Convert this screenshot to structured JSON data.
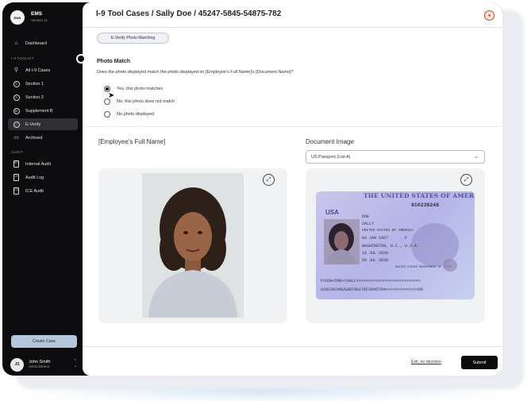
{
  "brand": {
    "logo_text": "EMS",
    "name": "EMS",
    "version": "Version 11"
  },
  "sidebar": {
    "dashboard": "Dashboard",
    "section_toolkit": "I-9 TOOLKIT",
    "items": [
      {
        "label": "All I-9 Cases",
        "icon": "search-icon"
      },
      {
        "label": "Section 1",
        "icon": "number-1-icon",
        "glyph": "1"
      },
      {
        "label": "Section 2",
        "icon": "number-2-icon",
        "glyph": "2"
      },
      {
        "label": "Supplement B",
        "icon": "letter-b-icon",
        "glyph": "B"
      },
      {
        "label": "E-Verify",
        "icon": "check-circle-icon",
        "glyph": "✓",
        "active": true
      },
      {
        "label": "Archived",
        "icon": "archive-icon"
      }
    ],
    "section_audit": "AUDIT",
    "audit_items": [
      {
        "label": "Internal Audit",
        "icon": "document-icon",
        "glyph": "INT"
      },
      {
        "label": "Audit Log",
        "icon": "document-icon",
        "glyph": "LOG"
      },
      {
        "label": "ICE Audit",
        "icon": "document-icon",
        "glyph": "ICE"
      }
    ],
    "create_case": "Create Case",
    "user": {
      "initials": "JS",
      "name": "John Smith",
      "role": "Administrator"
    }
  },
  "header": {
    "title": "I-9 Tool Cases / Sally Doe / 45247-5845-54875-782"
  },
  "tab": {
    "label": "E-Verify Photo Matching"
  },
  "photo_match": {
    "title": "Photo Match",
    "question": "Does the photo displayed match the photo displayed on [Employee's Full Name]'s [Document Name]?",
    "options": [
      {
        "label": "Yes, this photo matches",
        "selected": true
      },
      {
        "label": "No, this photo does not match",
        "selected": false
      },
      {
        "label": "No photo displayed",
        "selected": false
      }
    ]
  },
  "employee": {
    "heading": "[Employee's Full Name]"
  },
  "document": {
    "heading": "Document Image",
    "select_value": "US Passport (List A)",
    "passport": {
      "header": "THE UNITED STATES OF AMERICA",
      "country": "USA",
      "number": "910239248",
      "surname": "DOE",
      "given": "SALLY",
      "nationality": "UNITED STATES OF AMERICA",
      "dob": "03 JAN 1987",
      "sex": "F",
      "birthplace": "WASHINGTON, D.C., U.S.A.",
      "issued": "10 JUL 2020",
      "expires": "09 JUL 2030",
      "authority": "UNITED STATES DEPARTMENT OF STATE",
      "mrz1": "P<USA<DOE<<SALLY<<<<<<<<<<<<<<<<<<<<<<<<<<",
      "mrz2": "910239248USA8708176F3045704<<<<<<<<<<<<<<00"
    }
  },
  "footer": {
    "exit": "Exit, no decision",
    "submit": "Submit"
  },
  "colors": {
    "sidebar_bg": "#0c0c0e",
    "active_item": "#2e2f33",
    "create_btn": "#b4c6da",
    "submit_bg": "#0b0b0b"
  }
}
